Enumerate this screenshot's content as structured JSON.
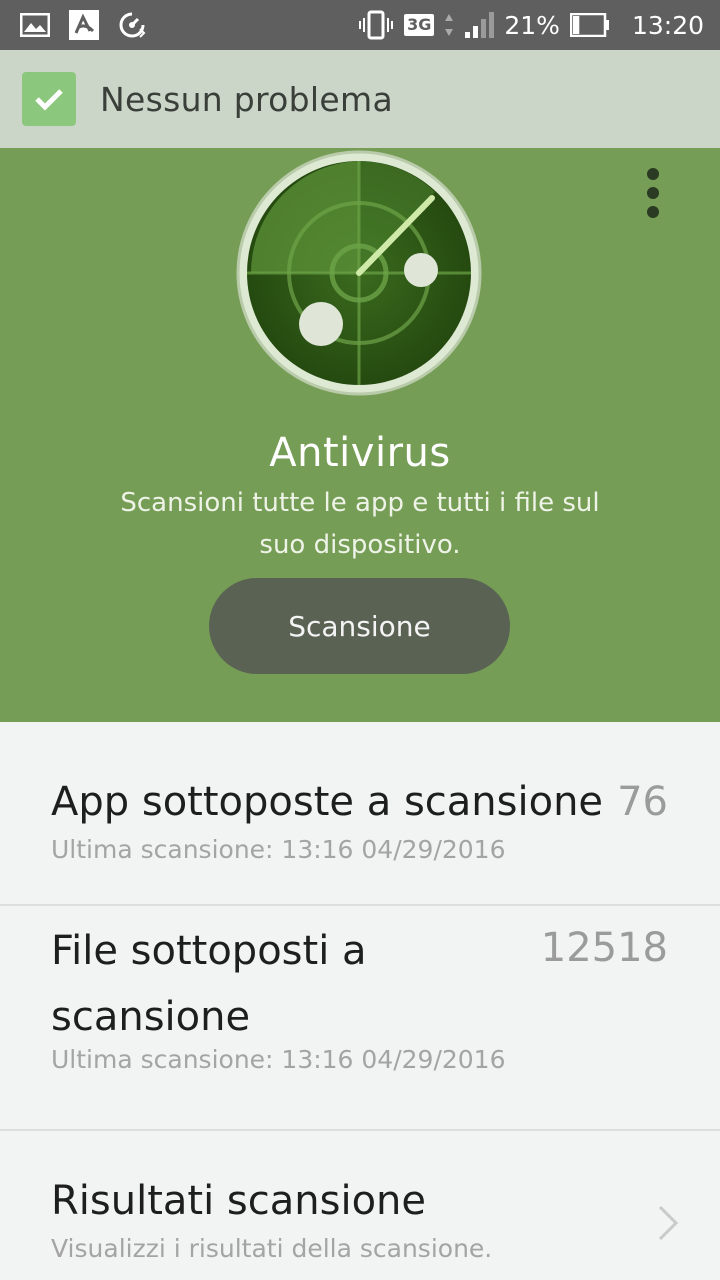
{
  "status_bar": {
    "icons_left": [
      "gallery-icon",
      "avira-icon",
      "speed-icon"
    ],
    "network": "3G",
    "battery": "21%",
    "battery_level": 0.21,
    "time": "13:20"
  },
  "header": {
    "title": "Nessun problema",
    "status_color": "#8cc77e"
  },
  "hero": {
    "title": "Antivirus",
    "description": "Scansioni tutte le app e tutti i file sul suo dispositivo.",
    "scan_button_label": "Scansione",
    "background": "#769d55"
  },
  "list": {
    "apps": {
      "title": "App sottoposte a scansione",
      "value": "76",
      "subtitle": "Ultima scansione: 13:16 04/29/2016"
    },
    "files": {
      "title": "File sottoposti a scansione",
      "value": "12518",
      "subtitle": "Ultima scansione: 13:16 04/29/2016"
    },
    "results": {
      "title": "Risultati scansione",
      "subtitle": "Visualizzi i risultati della scansione."
    }
  }
}
